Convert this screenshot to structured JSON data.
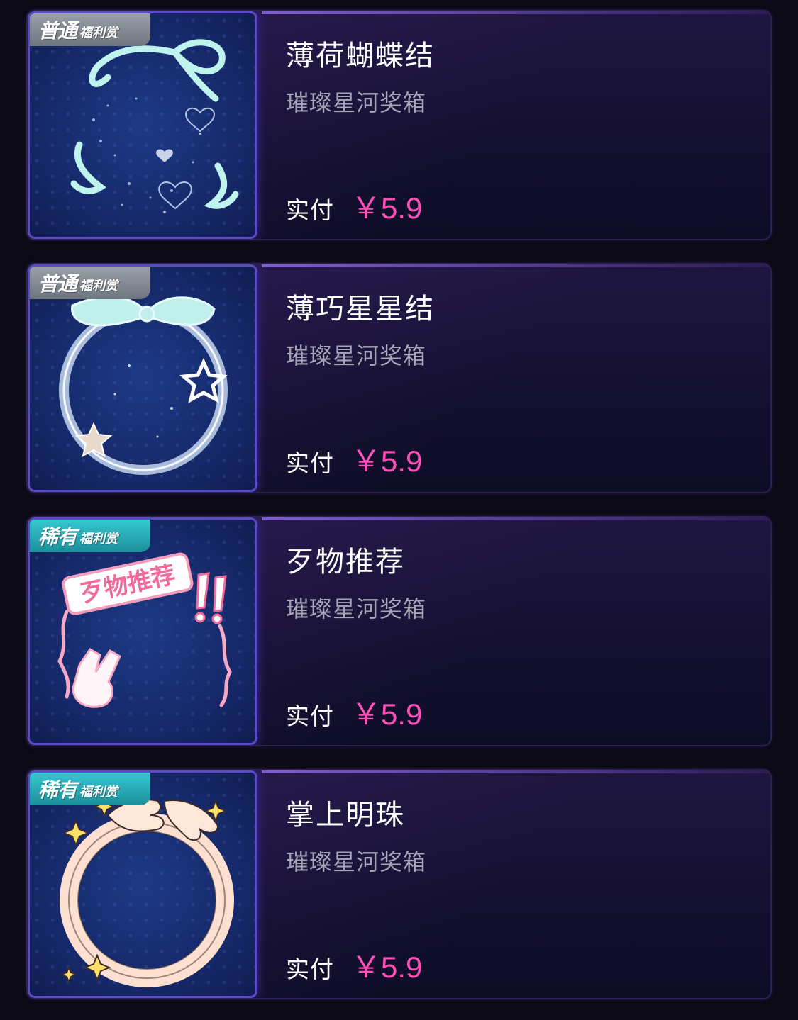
{
  "items": [
    {
      "badge_main": "普通",
      "badge_sub": "福利赏",
      "badge_type": "normal",
      "name": "薄荷蝴蝶结",
      "subtitle": "璀璨星河奖箱",
      "pay_label": "实付",
      "price": "￥5.9",
      "art": "ribbon-heart-frame-icon"
    },
    {
      "badge_main": "普通",
      "badge_sub": "福利赏",
      "badge_type": "normal",
      "name": "薄巧星星结",
      "subtitle": "璀璨星河奖箱",
      "pay_label": "实付",
      "price": "￥5.9",
      "art": "ribbon-star-frame-icon"
    },
    {
      "badge_main": "稀有",
      "badge_sub": "福利赏",
      "badge_type": "rare",
      "name": "歹物推荐",
      "subtitle": "璀璨星河奖箱",
      "pay_label": "实付",
      "price": "￥5.9",
      "art": "recommend-frame-icon",
      "art_text": "歹物推荐"
    },
    {
      "badge_main": "稀有",
      "badge_sub": "福利赏",
      "badge_type": "rare",
      "name": "掌上明珠",
      "subtitle": "璀璨星河奖箱",
      "pay_label": "实付",
      "price": "￥5.9",
      "art": "hands-ring-frame-icon"
    }
  ],
  "colors": {
    "price": "#ff4fb8",
    "badge_normal": "#8a9098",
    "badge_rare": "#2bb4bd",
    "background": "#0a0915"
  }
}
